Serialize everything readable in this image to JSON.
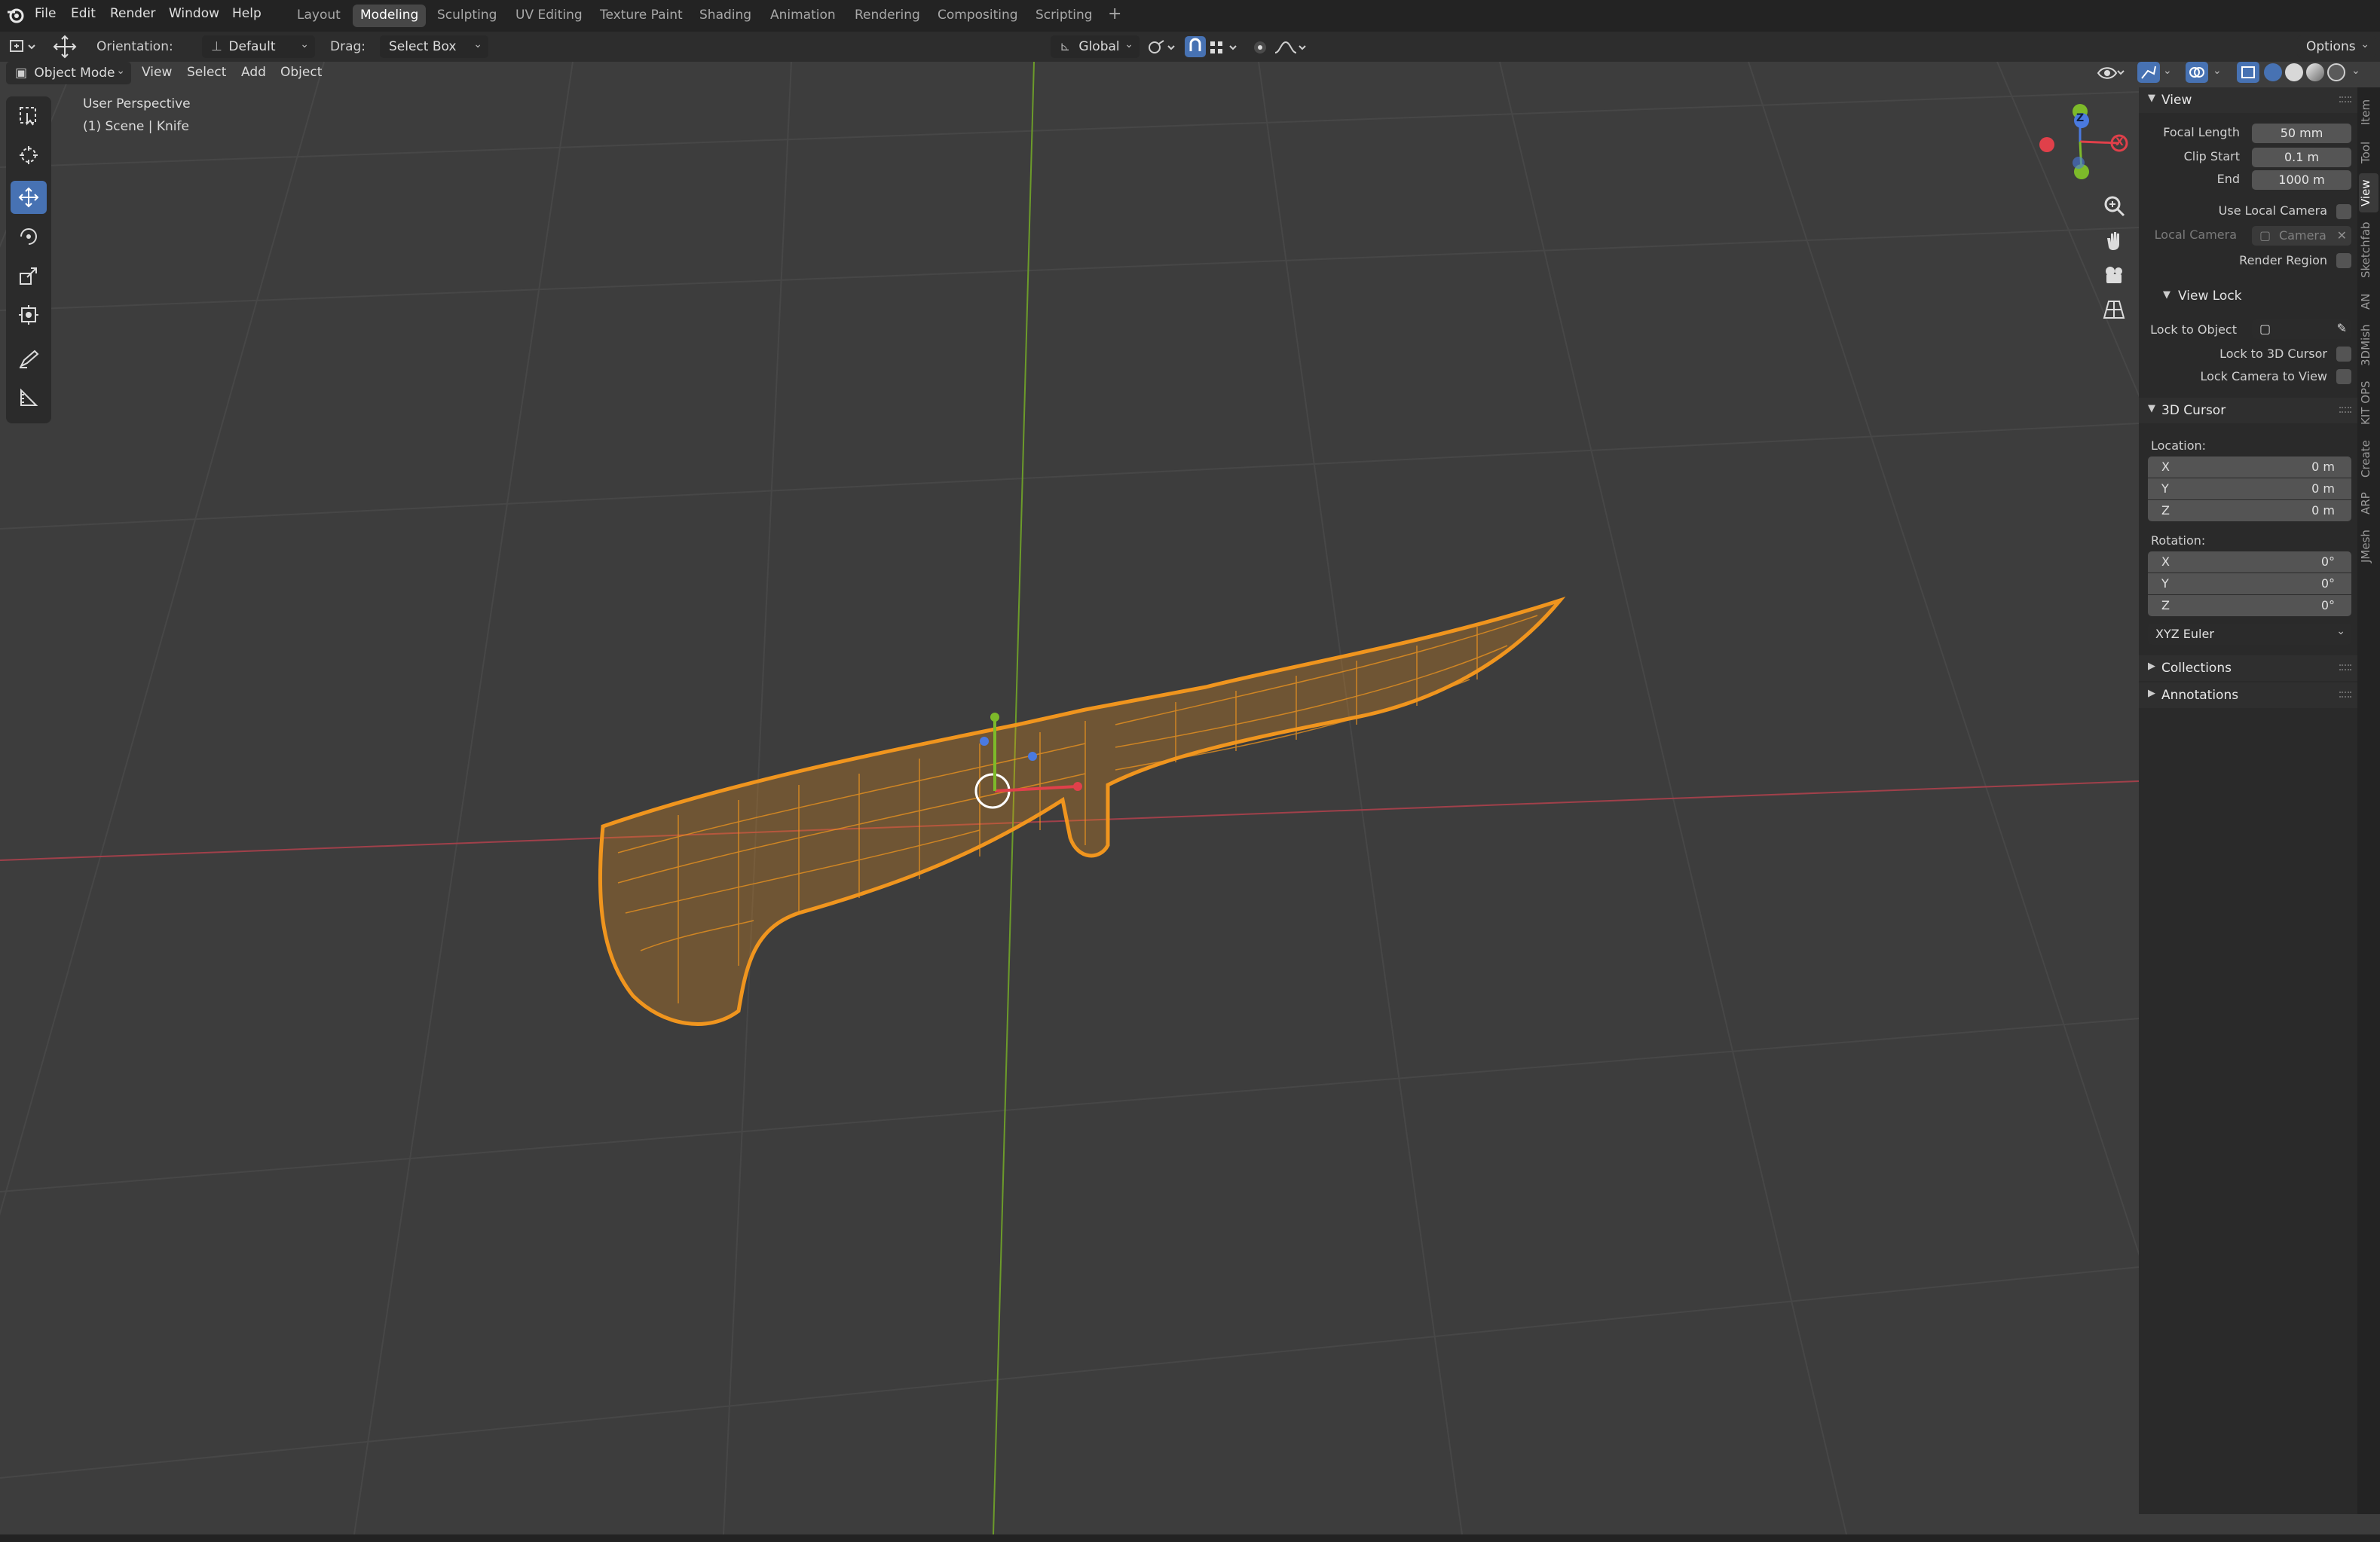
{
  "menubar": {
    "menus": [
      "File",
      "Edit",
      "Render",
      "Window",
      "Help"
    ],
    "workspaces": [
      "Layout",
      "Modeling",
      "Sculpting",
      "UV Editing",
      "Texture Paint",
      "Shading",
      "Animation",
      "Rendering",
      "Compositing",
      "Scripting"
    ],
    "active_workspace": "Modeling",
    "add_tab": "+"
  },
  "toolheader": {
    "orientation_label": "Orientation:",
    "orientation_value": "Default",
    "drag_label": "Drag:",
    "drag_value": "Select Box",
    "transform_orientation": "Global",
    "options_label": "Options"
  },
  "viewport_header": {
    "mode": "Object Mode",
    "menus": [
      "View",
      "Select",
      "Add",
      "Object"
    ]
  },
  "viewport": {
    "perspective_label": "User Perspective",
    "scene_label": "(1) Scene | Knife",
    "gizmo_axes": {
      "x": "X",
      "y": "Y",
      "z": "Z"
    },
    "object_color": "#f0951e",
    "grid_color": "#474747",
    "x_axis_color": "#a0404a",
    "y_axis_color": "#6c9b2a"
  },
  "sidebar": {
    "tabs": [
      "Item",
      "Tool",
      "View",
      "Sketchfab",
      "AN",
      "3DMish",
      "KIT OPS",
      "Create",
      "ARP",
      "JMesh"
    ],
    "active_tab": "View",
    "view_panel": {
      "title": "View",
      "focal_length_label": "Focal Length",
      "focal_length_value": "50 mm",
      "clip_start_label": "Clip Start",
      "clip_start_value": "0.1 m",
      "clip_end_label": "End",
      "clip_end_value": "1000 m",
      "use_local_camera_label": "Use Local Camera",
      "local_camera_label": "Local Camera",
      "local_camera_placeholder": "Camera",
      "render_region_label": "Render Region"
    },
    "view_lock": {
      "title": "View Lock",
      "lock_to_object_label": "Lock to Object",
      "lock_to_3d_cursor_label": "Lock to 3D Cursor",
      "lock_camera_to_view_label": "Lock Camera to View"
    },
    "cursor_panel": {
      "title": "3D Cursor",
      "location_label": "Location:",
      "location": [
        {
          "axis": "X",
          "value": "0 m"
        },
        {
          "axis": "Y",
          "value": "0 m"
        },
        {
          "axis": "Z",
          "value": "0 m"
        }
      ],
      "rotation_label": "Rotation:",
      "rotation": [
        {
          "axis": "X",
          "value": "0°"
        },
        {
          "axis": "Y",
          "value": "0°"
        },
        {
          "axis": "Z",
          "value": "0°"
        }
      ],
      "rotation_mode": "XYZ Euler"
    },
    "collections_title": "Collections",
    "annotations_title": "Annotations"
  }
}
